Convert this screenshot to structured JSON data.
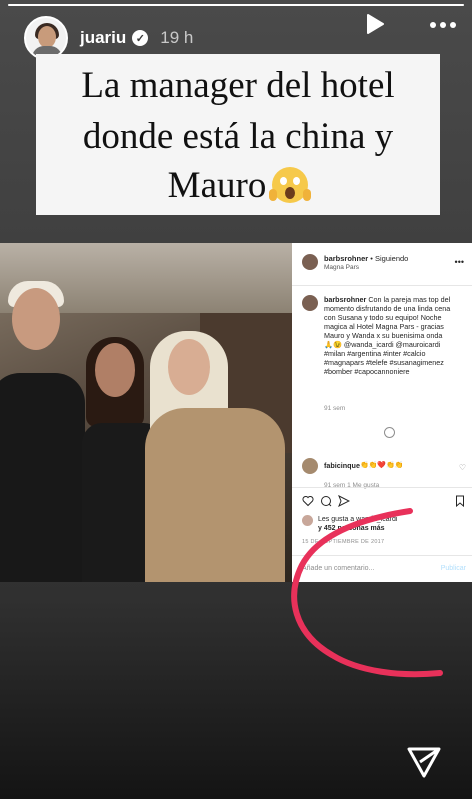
{
  "story": {
    "progress": 1.0
  },
  "header": {
    "username": "juariu",
    "verified_icon": "verified-badge-icon",
    "time": "19 h",
    "play_icon": "play-icon",
    "more_icon": "more-dots-icon"
  },
  "caption": {
    "line1": "La manager del hotel",
    "line2": "donde está la china y",
    "line3": "Mauro",
    "emoji": "face-screaming-in-fear"
  },
  "post": {
    "user": "barbsrohner",
    "follow_status": "• Siguiendo",
    "location": "Magna Pars",
    "caption_user": "barbsrohner",
    "caption_text": "Con la pareja mas top del momento disfrutando de una linda cena con Susana y todo su equipo! Noche magica al Hotel Magna Pars - gracias Mauro y Wanda x su buenisima onda 🙏😉 @wanda_icardi @mauroicardi #milan #argentina #inter #calcio #magnapars #telefe #susanagimenez #bomber #capocannoniere",
    "caption_time": "91 sem",
    "comment_user": "fabicinque",
    "comment_hearts": "👏👏❤️👏👏",
    "comment_meta": "91 sem    1 Me gusta",
    "likes_line1": "Les gusta a wanda_icardi",
    "likes_line2": "y 452 personas más",
    "date": "15 DE SEPTIEMBRE DE 2017",
    "add_comment_placeholder": "Añade un comentario...",
    "publish_label": "Publicar"
  },
  "annotation": {
    "color": "#e8315a"
  },
  "footer": {
    "share_icon": "send-icon"
  }
}
